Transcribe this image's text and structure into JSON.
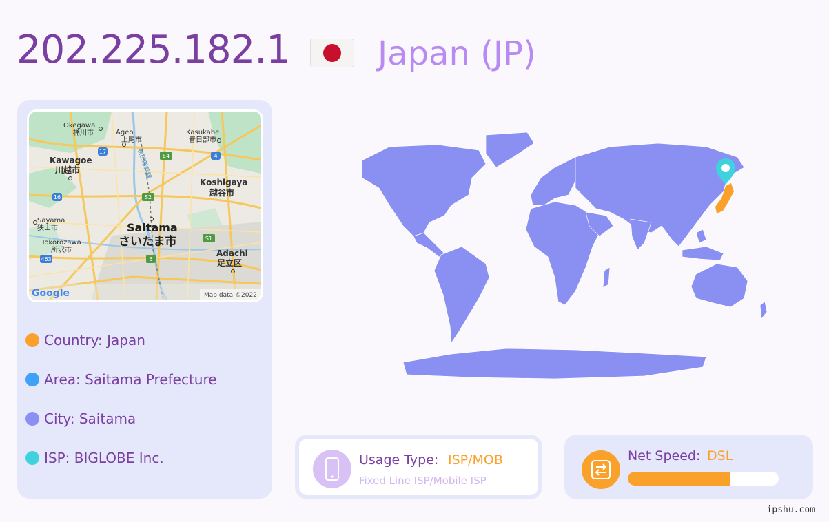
{
  "header": {
    "ip": "202.225.182.1",
    "country_title": "Japan (JP)",
    "flag_icon": "japan-flag-icon"
  },
  "colors": {
    "primary": "#7a3fa0",
    "accent": "#b98af2",
    "orange": "#f9a12b",
    "blue": "#3fa2f6",
    "periwinkle": "#8a8ff2",
    "teal": "#3fd2de",
    "panel": "#e5e8fa",
    "map_land": "#8a8ff2"
  },
  "mini_map": {
    "places": [
      {
        "name": "Okegawa",
        "ja": "桶川市"
      },
      {
        "name": "Ageo",
        "ja": "上尾市"
      },
      {
        "name": "Kasukabe",
        "ja": "春日部市"
      },
      {
        "name": "Kawagoe",
        "ja": "川越市"
      },
      {
        "name": "Koshigaya",
        "ja": "越谷市"
      },
      {
        "name": "Sayama",
        "ja": "狭山市"
      },
      {
        "name": "Saitama",
        "ja": "さいたま市"
      },
      {
        "name": "Tokorozawa",
        "ja": "所沢市"
      },
      {
        "name": "Adachi",
        "ja": "足立区"
      }
    ],
    "rail_label": "秋田新幹線",
    "route_badges": [
      "17",
      "E4",
      "4",
      "16",
      "S2",
      "S1",
      "5",
      "463"
    ],
    "logo": "Google",
    "attribution": "Map data ©2022"
  },
  "info": [
    {
      "label": "Country: Japan",
      "color": "#f9a12b",
      "icon": "orange-dot-icon"
    },
    {
      "label": "Area: Saitama Prefecture",
      "color": "#3fa2f6",
      "icon": "blue-dot-icon"
    },
    {
      "label": "City: Saitama",
      "color": "#8a8ff2",
      "icon": "purple-dot-icon"
    },
    {
      "label": "ISP: BIGLOBE Inc.",
      "color": "#3fd2de",
      "icon": "teal-dot-icon"
    }
  ],
  "usage": {
    "label": "Usage Type:",
    "value": "ISP/MOB",
    "description": "Fixed Line ISP/Mobile ISP",
    "icon": "mobile-phone-icon"
  },
  "speed": {
    "label": "Net Speed:",
    "value": "DSL",
    "level": 0.68,
    "icon": "network-device-icon"
  },
  "footer": {
    "watermark": "ipshu.com"
  }
}
